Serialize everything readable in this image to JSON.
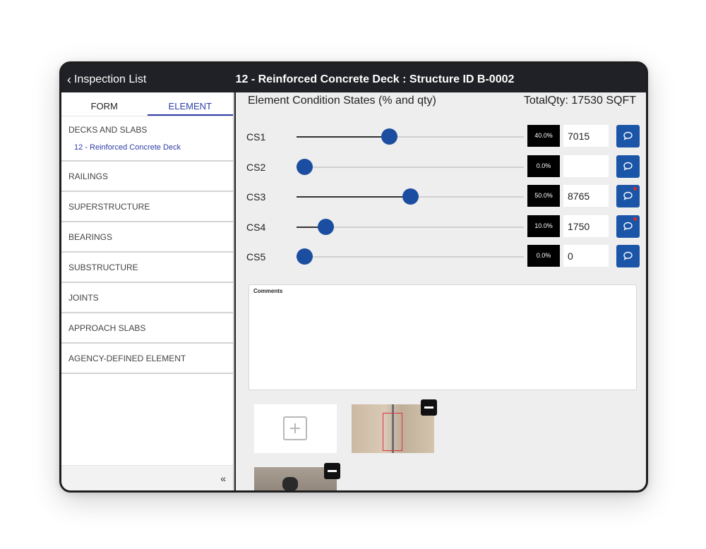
{
  "header": {
    "back_label": "Inspection List",
    "title": "12 - Reinforced Concrete Deck : Structure ID B-0002"
  },
  "sidebar": {
    "tabs": [
      {
        "label": "FORM",
        "active": false
      },
      {
        "label": "ELEMENT",
        "active": true
      }
    ],
    "categories": [
      {
        "label": "DECKS AND SLABS",
        "sub": "12 - Reinforced Concrete Deck"
      },
      {
        "label": "RAILINGS"
      },
      {
        "label": "SUPERSTRUCTURE"
      },
      {
        "label": "BEARINGS"
      },
      {
        "label": "SUBSTRUCTURE"
      },
      {
        "label": "JOINTS"
      },
      {
        "label": "APPROACH SLABS"
      },
      {
        "label": "AGENCY-DEFINED ELEMENT"
      }
    ],
    "collapse_glyph": "«"
  },
  "main": {
    "section_title": "Element Condition States (% and qty)",
    "total_qty": "TotalQty: 17530 SQFT",
    "rows": [
      {
        "label": "CS1",
        "percent_text": "40.0%",
        "level": 0.4,
        "qty": "7015",
        "has_comment": false
      },
      {
        "label": "CS2",
        "percent_text": "0.0%",
        "level": 0.0,
        "qty": "",
        "has_comment": false
      },
      {
        "label": "CS3",
        "percent_text": "50.0%",
        "level": 0.5,
        "qty": "8765",
        "has_comment": true
      },
      {
        "label": "CS4",
        "percent_text": "10.0%",
        "level": 0.1,
        "qty": "1750",
        "has_comment": true
      },
      {
        "label": "CS5",
        "percent_text": "0.0%",
        "level": 0.0,
        "qty": "0",
        "has_comment": false
      }
    ],
    "comments_label": "Comments",
    "comments_value": ""
  },
  "colors": {
    "accent": "#2f3ea8",
    "slider_thumb": "#1b4ea0",
    "comment_button": "#1b55a8",
    "comment_dot": "#e02828"
  },
  "icons": {
    "back": "chevron-left-icon",
    "comment": "speech-bubble-icon",
    "add_photo": "plus-square-icon",
    "remove_photo": "minus-icon"
  }
}
